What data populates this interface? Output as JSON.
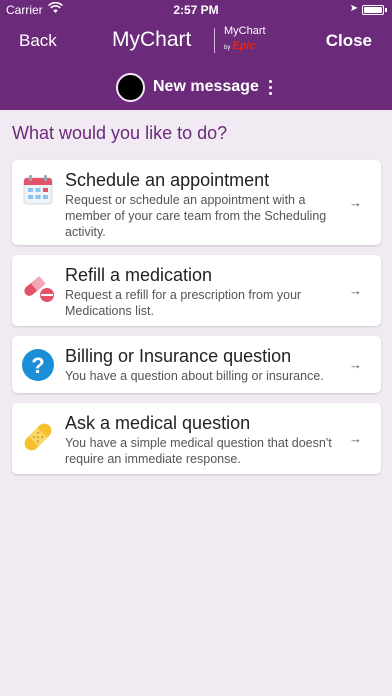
{
  "status_bar": {
    "carrier": "Carrier",
    "time": "2:57 PM"
  },
  "header": {
    "back_label": "Back",
    "close_label": "Close",
    "logo_my": "My",
    "logo_chart": "Chart",
    "logo_small_mychart": "MyChart",
    "logo_by": "by",
    "logo_epic": "Epic",
    "recipient_label": "New message"
  },
  "prompt": "What would you like to do?",
  "options": [
    {
      "title": "Schedule an appointment",
      "description": "Request or schedule an appointment with a member of your care team from the Scheduling activity.",
      "icon": "calendar-icon"
    },
    {
      "title": "Refill a medication",
      "description": "Request a refill for a prescription from your Medications list.",
      "icon": "pill-icon"
    },
    {
      "title": "Billing or Insurance question",
      "description": "You have a question about billing or insurance.",
      "icon": "question-icon"
    },
    {
      "title": "Ask a medical question",
      "description": "You have a simple medical question that doesn't require an immediate response.",
      "icon": "bandage-icon"
    }
  ],
  "arrow_glyph": "→",
  "colors": {
    "brand_purple": "#6b2a7a",
    "background": "#f1eaf3",
    "question_blue": "#1a8fd8",
    "bandage_yellow": "#f7c12e",
    "pill_red": "#e2536a"
  }
}
